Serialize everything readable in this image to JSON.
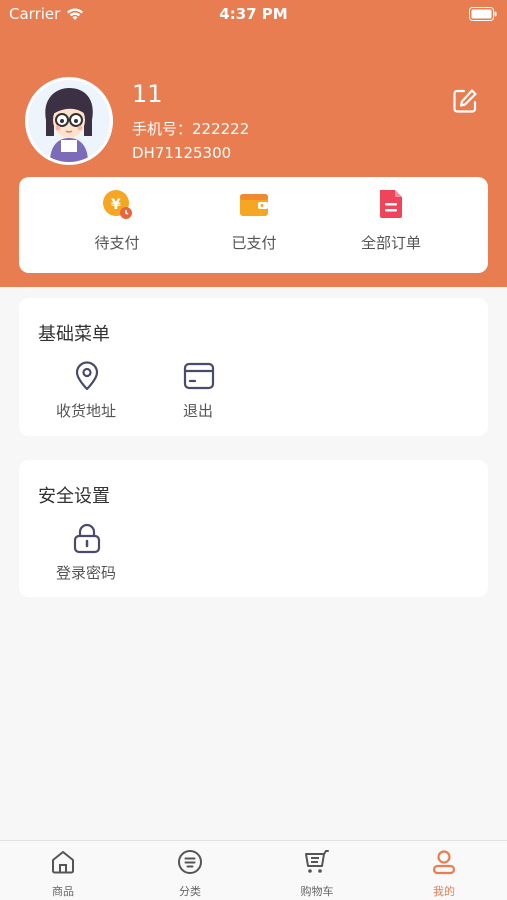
{
  "status_bar": {
    "carrier": "Carrier",
    "time": "4:37 PM"
  },
  "profile": {
    "name": "11",
    "phone": "手机号：222222",
    "id": "DH71125300"
  },
  "orders": [
    {
      "label": "待支付",
      "icon": "yuan-clock-icon"
    },
    {
      "label": "已支付",
      "icon": "wallet-icon"
    },
    {
      "label": "全部订单",
      "icon": "document-icon"
    }
  ],
  "basic_menu": {
    "title": "基础菜单",
    "items": [
      {
        "label": "收货地址",
        "icon": "location-pin-icon"
      },
      {
        "label": "退出",
        "icon": "card-icon"
      }
    ]
  },
  "security": {
    "title": "安全设置",
    "items": [
      {
        "label": "登录密码",
        "icon": "lock-icon"
      }
    ]
  },
  "tabs": [
    {
      "label": "商品",
      "icon": "home-icon"
    },
    {
      "label": "分类",
      "icon": "category-icon"
    },
    {
      "label": "购物车",
      "icon": "cart-icon"
    },
    {
      "label": "我的",
      "icon": "user-icon",
      "active": true
    }
  ],
  "colors": {
    "accent": "#e87d52",
    "icon_stroke": "#4a4a6a"
  }
}
